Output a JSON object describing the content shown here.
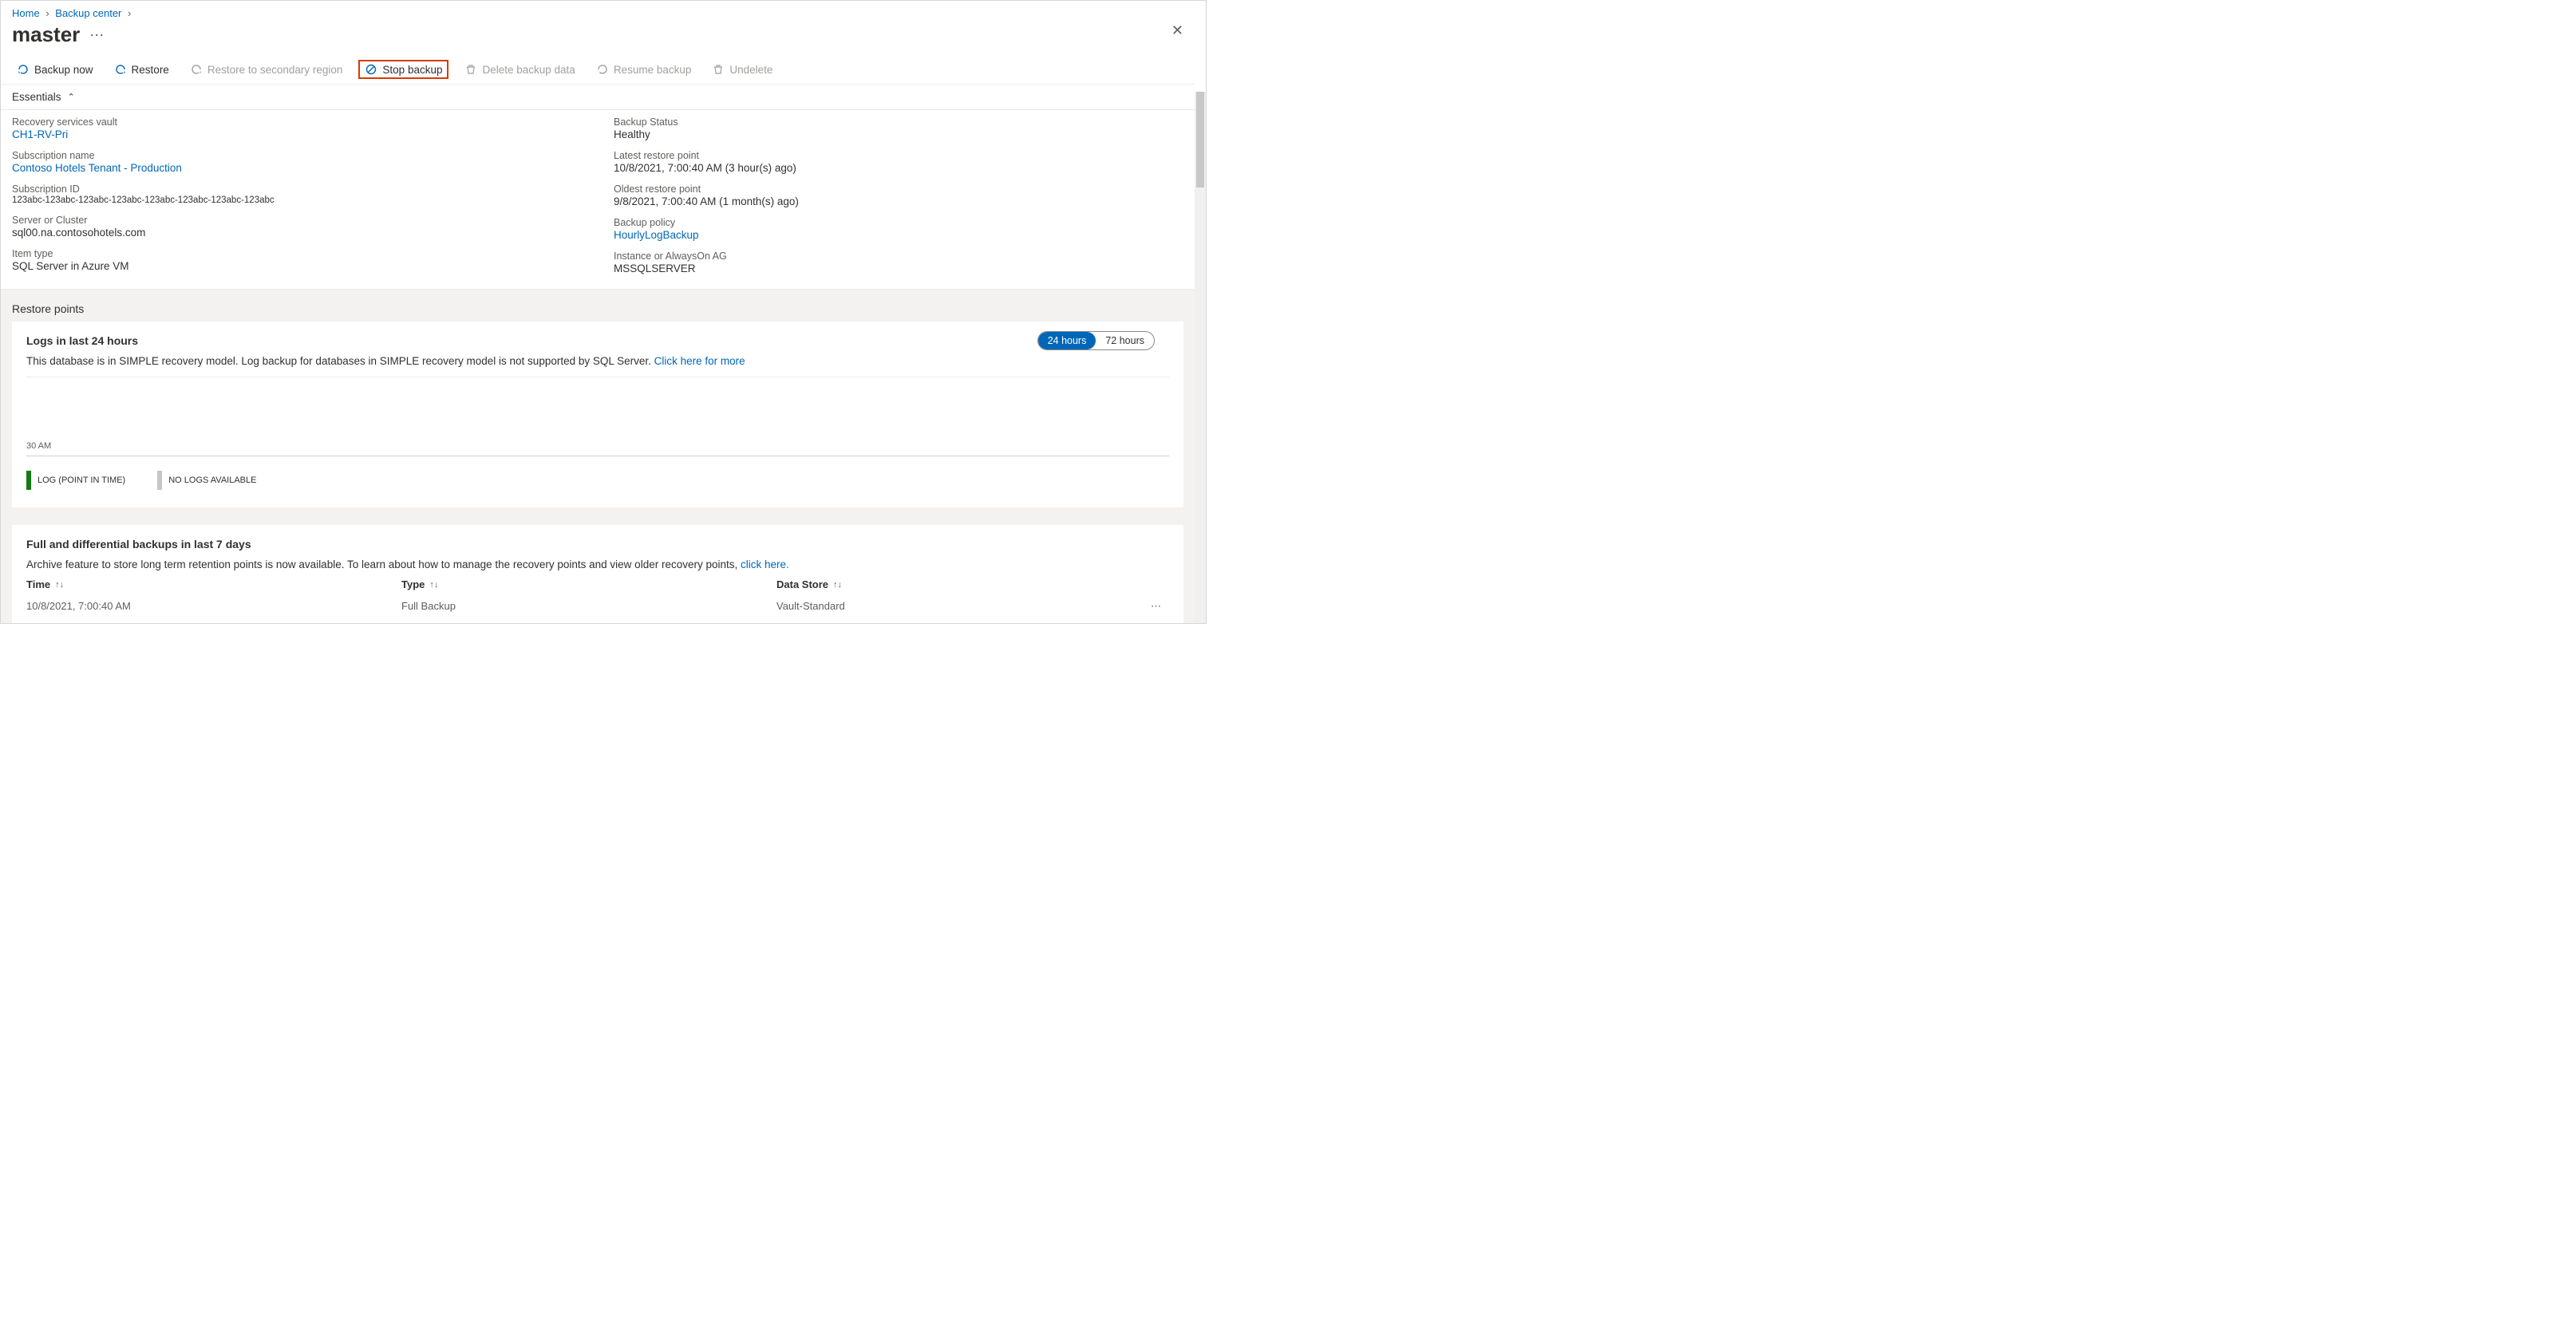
{
  "breadcrumb": {
    "home": "Home",
    "backup_center": "Backup center"
  },
  "title": "master",
  "toolbar": {
    "backup_now": "Backup now",
    "restore": "Restore",
    "restore_secondary": "Restore to secondary region",
    "stop_backup": "Stop backup",
    "delete_backup_data": "Delete backup data",
    "resume_backup": "Resume backup",
    "undelete": "Undelete"
  },
  "essentials_label": "Essentials",
  "essentials": {
    "left": [
      {
        "label": "Recovery services vault",
        "value": "CH1-RV-Pri",
        "link": true
      },
      {
        "label": "Subscription name",
        "value": "Contoso Hotels Tenant - Production",
        "link": true
      },
      {
        "label": "Subscription ID",
        "value": "123abc-123abc-123abc-123abc-123abc-123abc-123abc-123abc"
      },
      {
        "label": "Server or Cluster",
        "value": "sql00.na.contosohotels.com"
      },
      {
        "label": "Item type",
        "value": "SQL Server in Azure VM"
      }
    ],
    "right": [
      {
        "label": "Backup Status",
        "value": "Healthy"
      },
      {
        "label": "Latest restore point",
        "value": "10/8/2021, 7:00:40 AM (3 hour(s) ago)"
      },
      {
        "label": "Oldest restore point",
        "value": "9/8/2021, 7:00:40 AM (1 month(s) ago)"
      },
      {
        "label": "Backup policy",
        "value": "HourlyLogBackup",
        "link": true
      },
      {
        "label": "Instance or AlwaysOn AG",
        "value": "MSSQLSERVER"
      }
    ]
  },
  "restore_points_header": "Restore points",
  "logs": {
    "title": "Logs in last 24 hours",
    "desc": "This database is in SIMPLE recovery model. Log backup for databases in SIMPLE recovery model is not supported by SQL Server. ",
    "link": "Click here for more",
    "toggle": {
      "opt24": "24 hours",
      "opt72": "72 hours"
    },
    "tick": "30 AM",
    "legend": {
      "point": "LOG (POINT IN TIME)",
      "none": "NO LOGS AVAILABLE"
    }
  },
  "backups": {
    "title": "Full and differential backups in last 7 days",
    "desc": "Archive feature to store long term retention points is now available. To learn about how to manage the recovery points and view older recovery points, ",
    "link": "click here.",
    "columns": {
      "time": "Time",
      "type": "Type",
      "datastore": "Data Store"
    },
    "rows": [
      {
        "time": "10/8/2021, 7:00:40 AM",
        "type": "Full Backup",
        "datastore": "Vault-Standard"
      }
    ]
  }
}
